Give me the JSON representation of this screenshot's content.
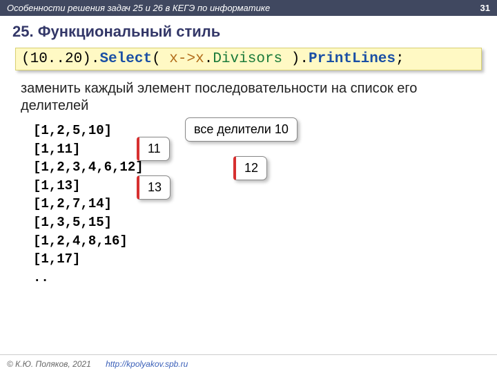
{
  "header": {
    "subject": "Особенности решения задач 25 и 26 в КЕГЭ по информатике",
    "page": "31"
  },
  "title": "25. Функциональный стиль",
  "code": {
    "range": "(10..20)",
    "dot1": ".",
    "select": "Select",
    "open": "( ",
    "lambda_lhs": "x",
    "arrow": "->",
    "lambda_var2": "x",
    "dot2": ".",
    "divisors": "Divisors",
    "close": " )",
    "dot3": ".",
    "printlines": "PrintLines",
    "semi": ";"
  },
  "explain": "заменить каждый элемент последовательности на список его делителей",
  "output": [
    "[1,2,5,10]",
    "[1,11]",
    "[1,2,3,4,6,12]",
    "[1,13]",
    "[1,2,7,14]",
    "[1,3,5,15]",
    "[1,2,4,8,16]",
    "[1,17]",
    ".."
  ],
  "callouts": {
    "all10": "все делители 10",
    "c11": "11",
    "c12": "12",
    "c13": "13"
  },
  "footer": {
    "copyright": "© К.Ю. Поляков, 2021",
    "link": "http://kpolyakov.spb.ru"
  }
}
